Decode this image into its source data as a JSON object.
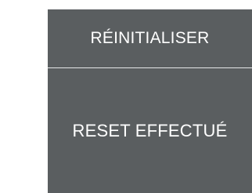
{
  "panel": {
    "reset_button_label": "RÉINITIALISER",
    "status_message": "RESET EFFECTUÉ"
  },
  "colors": {
    "panel_background": "#5a5e60",
    "text": "#ffffff",
    "divider": "#e6e7e8",
    "page_background": "#ffffff"
  }
}
